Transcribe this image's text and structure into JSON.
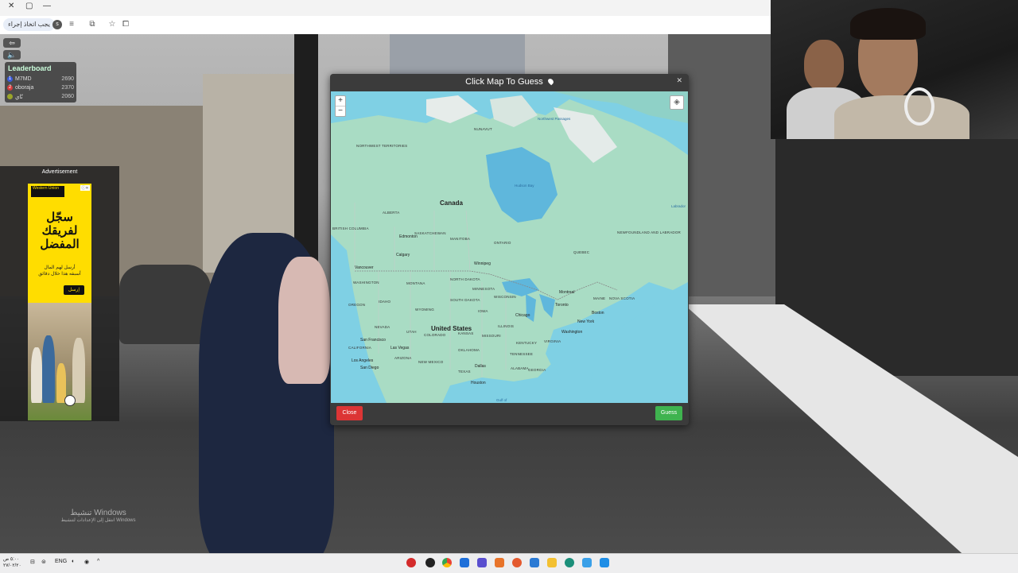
{
  "browser": {
    "address_chip": "يجب اتخاذ إجراء",
    "window_controls": {
      "close": "✕",
      "maximize": "▢",
      "minimize": "—"
    }
  },
  "hud": {
    "back_icon": "arrow-left-icon",
    "sound_icon": "speaker-icon"
  },
  "leaderboard": {
    "title": "Leaderboard",
    "rows": [
      {
        "rank": "1",
        "name": "M7MD",
        "score": "2690",
        "color": "#3b5bdb"
      },
      {
        "rank": "2",
        "name": "oboraja",
        "score": "2370",
        "color": "#d63b3b"
      },
      {
        "rank": "",
        "name": "نّاي",
        "score": "2060",
        "color": "#9aa52a"
      }
    ]
  },
  "ad": {
    "label": "Advertisement",
    "brand": "Western Union",
    "headline_l1": "سجّل",
    "headline_l2": "لفريقك",
    "headline_l3": "المفضل",
    "sub_l1": "أرسل لهم المال",
    "sub_l2": "أسبقه هذا خلال دقائق",
    "cta": "إرسل"
  },
  "modal": {
    "title": "Click Map To Guess",
    "close_label": "Close",
    "guess_label": "Guess",
    "zoom_in": "+",
    "zoom_out": "−",
    "map": {
      "country_canada": "Canada",
      "country_us": "United States",
      "labels": {
        "northwest": "NORTHWEST TERRITORIES",
        "nunavut": "NUNAVUT",
        "bc": "BRITISH COLUMBIA",
        "alberta": "ALBERTA",
        "sask": "SASKATCHEWAN",
        "manitoba": "MANITOBA",
        "ontario": "ONTARIO",
        "quebec": "QUEBEC",
        "nfld": "NEWFOUNDLAND AND LABRADOR",
        "washington": "WASHINGTON",
        "montana": "MONTANA",
        "ndakota": "NORTH DAKOTA",
        "minnesota": "MINNESOTA",
        "oregon": "OREGON",
        "idaho": "IDAHO",
        "wyoming": "WYOMING",
        "sdakota": "SOUTH DAKOTA",
        "nevada": "NEVADA",
        "utah": "UTAH",
        "colorado": "COLORADO",
        "kansas": "KANSAS",
        "california": "CALIFORNIA",
        "arizona": "ARIZONA",
        "newmexico": "NEW MEXICO",
        "texas": "TEXAS",
        "oklahoma": "OKLAHOMA",
        "iowa": "IOWA",
        "wisconsin": "WISCONSIN",
        "illinois": "ILLINOIS",
        "missouri": "MISSOURI",
        "kentucky": "KENTUCKY",
        "tennessee": "TENNESSEE",
        "alabama": "ALABAMA",
        "georgia": "GEORGIA",
        "virginia": "VIRGINIA",
        "nova_scotia": "NOVA SCOTIA",
        "maine": "MAINE"
      },
      "water": {
        "hudson": "Hudson Bay",
        "northwest_passages": "Northwest Passages",
        "labrador": "Labrador",
        "gulf": "Gulf of"
      },
      "cities": {
        "edmonton": "Edmonton",
        "calgary": "Calgary",
        "vancouver": "Vancouver",
        "winnipeg": "Winnipeg",
        "montreal": "Montreal",
        "toronto": "Toronto",
        "chicago": "Chicago",
        "boston": "Boston",
        "newyork": "New York",
        "washington": "Washington",
        "sf": "San Francisco",
        "lasvegas": "Las Vegas",
        "la": "Los Angeles",
        "sandiego": "San Diego",
        "dallas": "Dallas",
        "houston": "Houston"
      }
    }
  },
  "watermark": {
    "line1": "تنشيط Windows",
    "line2": "انتقل إلى الإعدادات لتنشيط Windows"
  },
  "taskbar": {
    "time": "٥:٠٠ ص",
    "date": "٢٧/٠٢/٢٠",
    "lang": "ENG"
  }
}
